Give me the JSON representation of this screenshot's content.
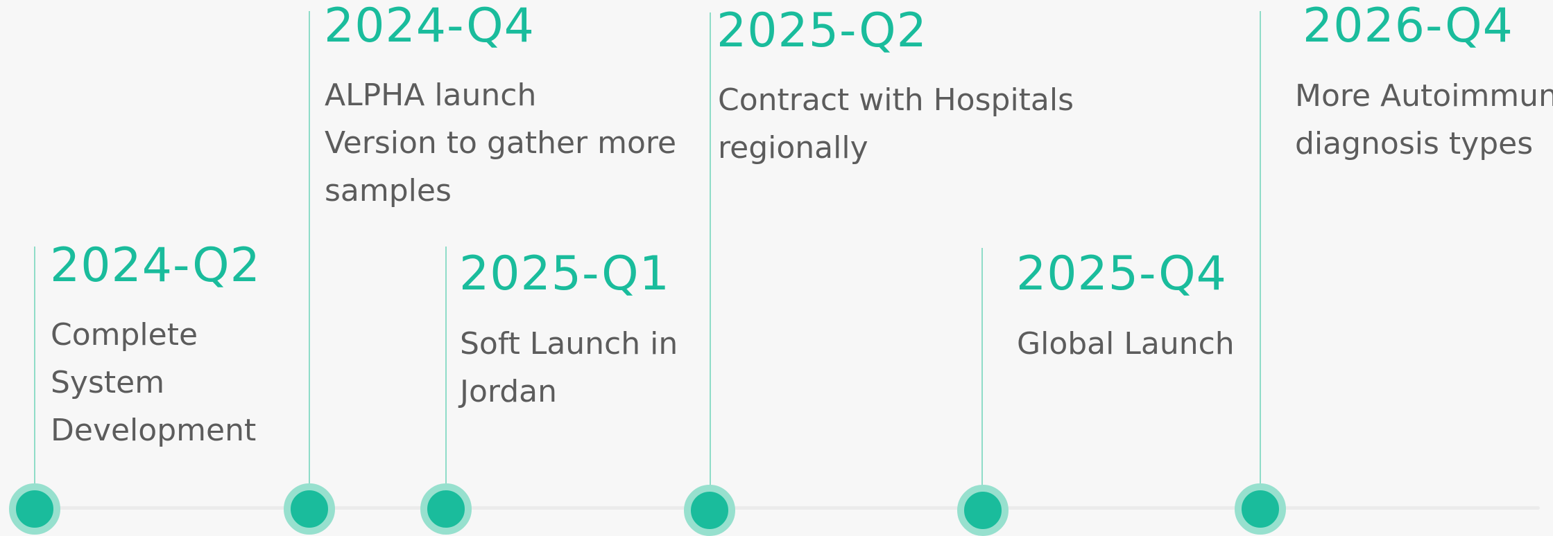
{
  "timeline": {
    "milestones": [
      {
        "date": "2024-Q2",
        "lines": [
          "Complete System",
          "Development"
        ]
      },
      {
        "date": "2024-Q4",
        "lines": [
          "ALPHA launch",
          "Version to gather more",
          "samples"
        ]
      },
      {
        "date": "2025-Q1",
        "lines": [
          "Soft Launch in",
          "Jordan"
        ]
      },
      {
        "date": "2025-Q2",
        "lines": [
          "Contract with Hospitals",
          "regionally"
        ]
      },
      {
        "date": "2025-Q4",
        "lines": [
          "Global Launch"
        ]
      },
      {
        "date": "2026-Q4",
        "lines": [
          "More Autoimmune",
          "diagnosis types"
        ]
      }
    ]
  },
  "colors": {
    "accent": "#1abc9c",
    "accent_light": "#97e0ce",
    "stem": "#8fdcc8",
    "text": "#5c5c5c",
    "axis": "#ebebeb",
    "background": "#f7f7f7"
  }
}
